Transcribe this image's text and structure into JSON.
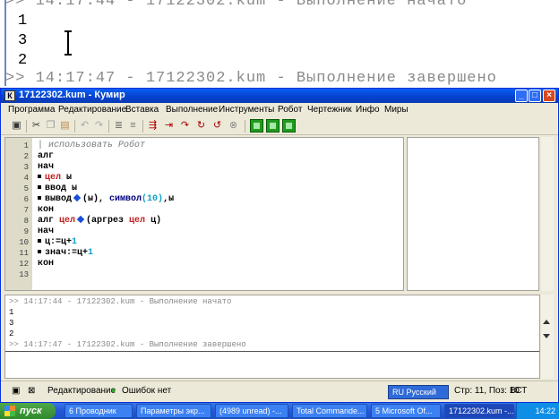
{
  "background_console": {
    "line_start": ">> 14:17:44 - 17122302.kum - Выполнение начато",
    "out1": "1",
    "out2": "3",
    "out3": "2",
    "line_end": ">> 14:17:47 - 17122302.kum - Выполнение завершено"
  },
  "window": {
    "title": "17122302.kum - Кумир",
    "app_icon": "К"
  },
  "menu": [
    "Программа",
    "Редактирование",
    "Вставка",
    "Выполнение",
    "Инструменты",
    "Робот",
    "Чертежник",
    "Инфо",
    "Миры"
  ],
  "editor": {
    "line_numbers": [
      "1",
      "2",
      "3",
      "4",
      "5",
      "6",
      "7",
      "8",
      "9",
      "10",
      "11",
      "12",
      "13"
    ],
    "lines": {
      "l1": "| использовать Робот",
      "l2": "алг",
      "l3": "нач",
      "l4_kw": "цел",
      "l4_rest": " ы",
      "l5_kw": "ввод",
      "l5_rest": " ы",
      "l6_kw": "вывод",
      "l6_mid": "(ы), ",
      "l6_fn": "символ",
      "l6_num": "(10)",
      "l6_end": ",ы",
      "l7": "кон",
      "l8_a": "алг ",
      "l8_t1": "цел",
      "l8_b": "(аргрез ",
      "l8_t2": "цел",
      "l8_c": " ц)",
      "l9": "нач",
      "l10_a": "ц:=ц+",
      "l10_n": "1",
      "l11_a": "знач:=ц+",
      "l11_n": "1",
      "l12": "кон"
    }
  },
  "console": {
    "start": ">> 14:17:44 - 17122302.kum - Выполнение начато",
    "out1": "1",
    "out2": "3",
    "out3": "2",
    "end": ">> 14:17:47 - 17122302.kum - Выполнение завершено"
  },
  "status": {
    "mode": "Редактирование",
    "errors": "Ошибок нет",
    "position": "Стр: 11, Поз: 10",
    "insert": "ВСТ",
    "language": "RU Русский"
  },
  "taskbar": {
    "start": "пуск",
    "tasks": [
      "6 Проводник",
      "Параметры экр...",
      "(4989 unread) -...",
      "Total Commande...",
      "5 Microsoft Of...",
      "17122302.kum -..."
    ],
    "clock": "14:22"
  },
  "colors": {
    "title_blue": "#0542cc",
    "keyword_type_red": "#c02020",
    "number_cyan": "#0aa0c8",
    "function_navy": "#000080"
  }
}
